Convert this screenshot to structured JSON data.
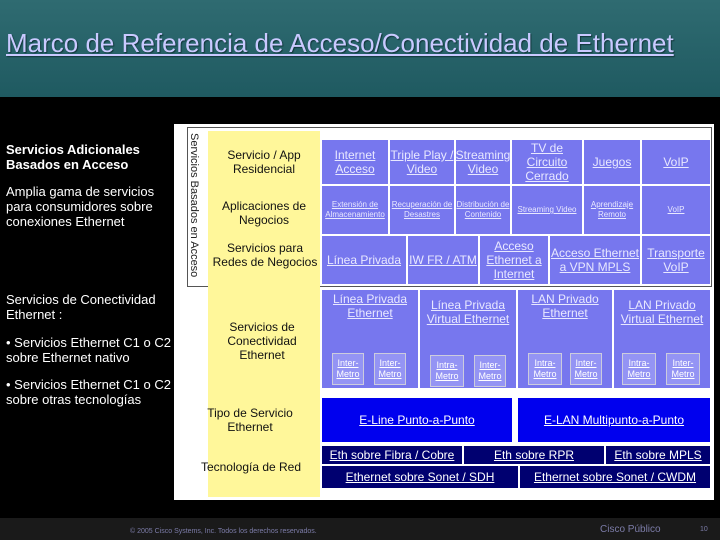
{
  "title": "Marco de Referencia de Acceso/Conectividad de Ethernet",
  "left": {
    "servicios_adicionales": "Servicios Adicionales Basados en Acceso",
    "amplia_gama": "Amplia gama de servicios para consumidores sobre conexiones Ethernet",
    "servicios_conectividad": "Servicios de Conectividad Ethernet :",
    "bullet1": "• Servicios Ethernet C1 o C2 sobre Ethernet nativo",
    "bullet2": "• Servicios Ethernet C1 o C2 sobre otras tecnologías"
  },
  "vertical_label": "Servicios Basados en Acceso",
  "yellow": {
    "servicio_app": "Servicio / App Residencial",
    "aplicaciones": "Aplicaciones de Negocios",
    "servicios_redes": "Servicios para Redes de Negocios",
    "conectividad": "Servicios de Conectividad Ethernet",
    "tipo_servicio": "Tipo de Servicio Ethernet",
    "tecnologia": "Tecnología de Red"
  },
  "row1": [
    "Internet Acceso",
    "Triple Play / Video",
    "Streaming Video",
    "TV de Circuito Cerrado",
    "Juegos",
    "VoIP"
  ],
  "row2": [
    "Extensión de Almacenamiento",
    "Recuperación de Desastres",
    "Distribución de Contenido",
    "Streaming Video",
    "Aprendizaje Remoto",
    "VoIP"
  ],
  "row3": [
    "Línea Privada",
    "IW FR / ATM",
    "Acceso Ethernet a Internet",
    "Acceso Ethernet a VPN MPLS",
    "Transporte VoIP"
  ],
  "row4": [
    "Línea Privada Ethernet",
    "Línea Privada Virtual Ethernet",
    "LAN Privado Ethernet",
    "LAN Privado Virtual Ethernet"
  ],
  "intermetro": [
    "Inter-Metro",
    "Inter-Metro",
    "Intra-Metro",
    "Inter-Metro",
    "Intra-Metro",
    "Inter-Metro",
    "Intra-Metro",
    "Inter-Metro"
  ],
  "eline": "E-Line Punto-a-Punto",
  "elan": "E-LAN Multipunto-a-Punto",
  "tech_row1": [
    "Eth sobre Fibra / Cobre",
    "Eth sobre RPR",
    "Eth sobre MPLS"
  ],
  "tech_row2": [
    "Ethernet sobre Sonet / SDH",
    "Ethernet sobre Sonet / CWDM"
  ],
  "footer": {
    "copyright": "© 2005 Cisco Systems, Inc. Todos los derechos reservados.",
    "public": "Cisco Público",
    "page": "10"
  },
  "colors": {
    "header": "#2f6b71",
    "title": "#c9c9ff",
    "yellow": "#fff79a",
    "purple": "#7777ee",
    "blue": "#0000ee",
    "navy": "#000070"
  }
}
